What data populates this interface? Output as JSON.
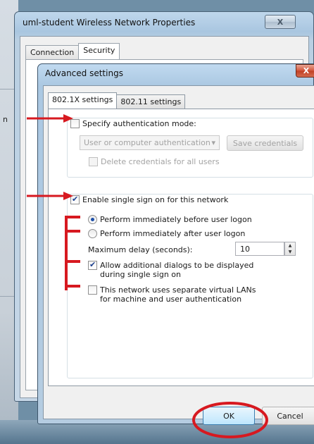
{
  "background": {
    "left_label": "n"
  },
  "back_window": {
    "title": "uml-student Wireless Network Properties",
    "close_label": "X",
    "tabs": [
      {
        "label": "Connection"
      },
      {
        "label": "Security"
      }
    ]
  },
  "dialog": {
    "title": "Advanced settings",
    "close_label": "X",
    "tabs": [
      {
        "label": "802.1X settings"
      },
      {
        "label": "802.11 settings"
      }
    ],
    "specify_auth": {
      "label": "Specify authentication mode:",
      "checked": false
    },
    "auth_select": {
      "value": "User or computer authentication",
      "enabled": false
    },
    "save_credentials_label": "Save credentials",
    "delete_credentials": {
      "label": "Delete credentials for all users",
      "checked": false,
      "enabled": false
    },
    "sso": {
      "label": "Enable single sign on for this network",
      "checked": true
    },
    "radio_before": {
      "label": "Perform immediately before user logon",
      "checked": true
    },
    "radio_after": {
      "label": "Perform immediately after user logon",
      "checked": false
    },
    "max_delay": {
      "label": "Maximum delay (seconds):",
      "value": "10"
    },
    "allow_dialogs": {
      "label": "Allow additional dialogs to be displayed during single sign on",
      "checked": true
    },
    "separate_vlans": {
      "label": "This network uses separate virtual LANs for machine and user authentication",
      "checked": false
    },
    "ok_label": "OK",
    "cancel_label": "Cancel"
  },
  "colors": {
    "annotation": "#d71920",
    "accent": "#3c7fb1"
  }
}
